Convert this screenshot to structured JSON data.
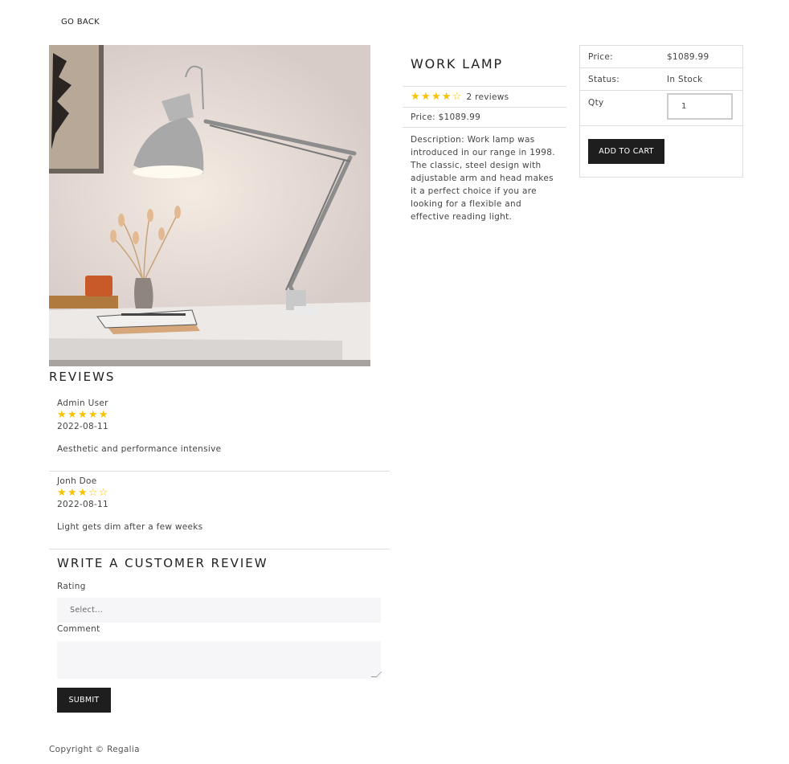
{
  "nav": {
    "go_back": "GO BACK"
  },
  "product": {
    "name": "WORK LAMP",
    "rating": 3.5,
    "reviews_text": "2 reviews",
    "price_line": "Price: $1089.99",
    "description": "Description: Work lamp was introduced in our range in 1998. The classic, steel design with adjustable arm and head makes it a perfect choice if you are looking for a flexible and effective reading light.",
    "image_alt": "work-lamp-photo"
  },
  "purchase": {
    "price_label": "Price:",
    "price_value": "$1089.99",
    "status_label": "Status:",
    "status_value": "In Stock",
    "qty_label": "Qty",
    "qty_value": "1",
    "add_to_cart": "ADD TO CART"
  },
  "reviews": {
    "heading": "REVIEWS",
    "items": [
      {
        "name": "Admin User",
        "rating": 5,
        "date": "2022-08-11",
        "comment": "Aesthetic and performance intensive"
      },
      {
        "name": "Jonh Doe",
        "rating": 3,
        "date": "2022-08-11",
        "comment": "Light gets dim after a few weeks"
      }
    ]
  },
  "write_review": {
    "heading": "WRITE A CUSTOMER REVIEW",
    "rating_label": "Rating",
    "rating_placeholder": "Select...",
    "comment_label": "Comment",
    "submit": "SUBMIT"
  },
  "footer": {
    "copyright": "Copyright © Regalia"
  },
  "colors": {
    "star": "#f8c200",
    "button": "#1e1e1e",
    "border": "#dddddd",
    "input_bg": "#f6f6f8"
  }
}
